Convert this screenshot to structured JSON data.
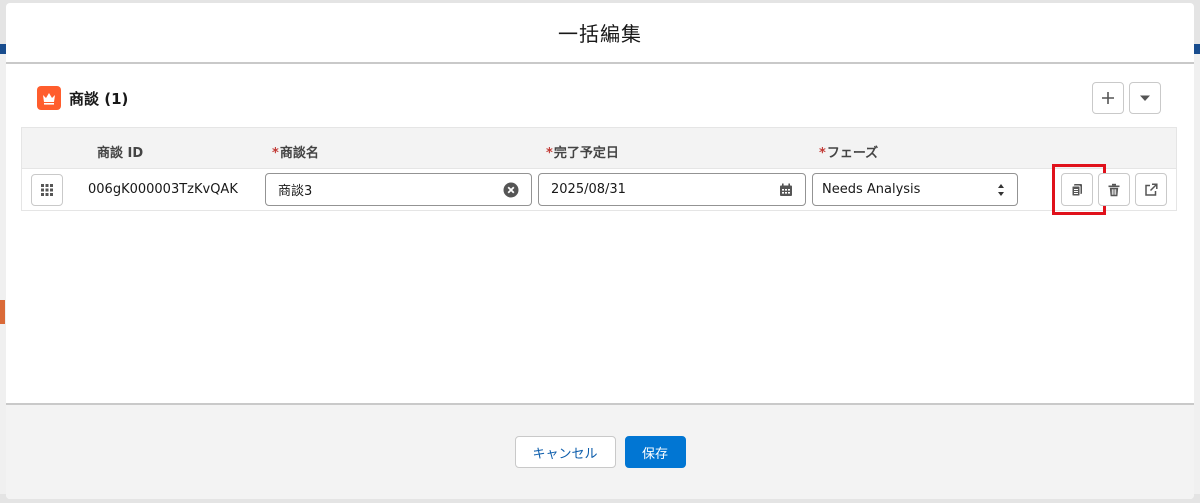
{
  "modal": {
    "title": "一括編集"
  },
  "section": {
    "title": "商談 (1)",
    "icon": "crown-icon",
    "icon_color": "#ff5d2d"
  },
  "header_actions": {
    "add_icon": "plus-icon",
    "menu_icon": "chevron-down-icon"
  },
  "grid": {
    "columns": [
      {
        "label": "商談 ID",
        "required": false
      },
      {
        "label": "商談名",
        "required": true
      },
      {
        "label": "完了予定日",
        "required": true
      },
      {
        "label": "フェーズ",
        "required": true
      }
    ],
    "required_marker": "*",
    "row": {
      "record_id": "006gK000003TzKvQAK",
      "name_value": "商談3",
      "close_date_value": "2025/08/31",
      "stage_value": "Needs Analysis"
    }
  },
  "row_actions": {
    "clone_icon": "copy-icon",
    "delete_icon": "trash-icon",
    "open_icon": "new-window-icon"
  },
  "footer": {
    "cancel_label": "キャンセル",
    "save_label": "保存"
  },
  "colors": {
    "brand": "#0176d3",
    "highlight": "#e0111b",
    "required": "#c23934"
  }
}
